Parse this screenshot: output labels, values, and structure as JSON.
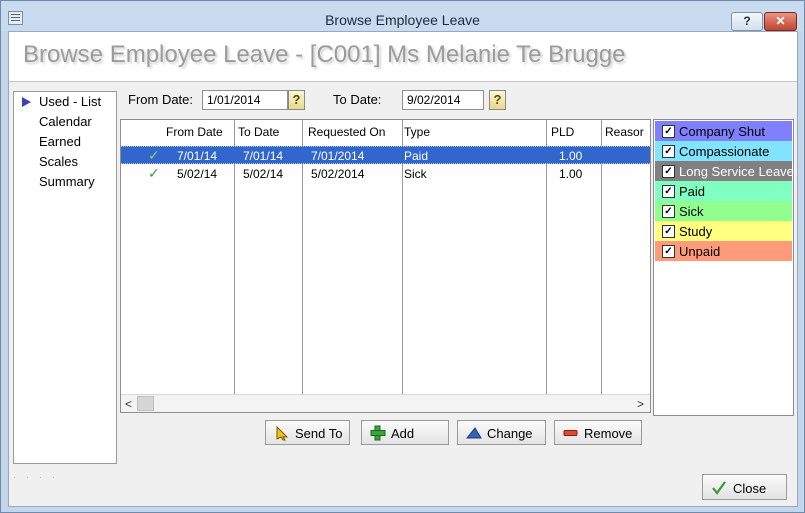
{
  "window": {
    "title": "Browse Employee Leave"
  },
  "titlebar_buttons": {
    "help": "?",
    "close": "✕"
  },
  "header": {
    "title": "Browse Employee Leave - [C001] Ms Melanie Te Brugge"
  },
  "nav": {
    "items": [
      "Used - List",
      "Calendar",
      "Earned",
      "Scales",
      "Summary"
    ],
    "selected_index": 0
  },
  "filters": {
    "from_label": "From Date:",
    "from_value": "1/01/2014",
    "to_label": "To Date:",
    "to_value": "9/02/2014",
    "lookup_symbol": "?"
  },
  "grid": {
    "columns": [
      "From Date",
      "To Date",
      "Requested On",
      "Type",
      "PLD",
      "Reasor"
    ],
    "rows": [
      {
        "from": "7/01/14",
        "to": "7/01/14",
        "requested": "7/01/2014",
        "type": "Paid",
        "pld": "1.00",
        "reason": "",
        "approved": true,
        "selected": true
      },
      {
        "from": "5/02/14",
        "to": "5/02/14",
        "requested": "5/02/2014",
        "type": "Sick",
        "pld": "1.00",
        "reason": "",
        "approved": true,
        "selected": false
      }
    ]
  },
  "leave_types": [
    {
      "label": "Company Shut",
      "color": "#8080ff",
      "text_color": "#000000",
      "checked": true
    },
    {
      "label": "Compassionate",
      "color": "#80e4ff",
      "text_color": "#000000",
      "checked": true
    },
    {
      "label": "Long Service Leave",
      "color": "#808080",
      "text_color": "#ffffff",
      "checked": true
    },
    {
      "label": "Paid",
      "color": "#80ffc0",
      "text_color": "#000000",
      "checked": true
    },
    {
      "label": "Sick",
      "color": "#90ff90",
      "text_color": "#000000",
      "checked": true
    },
    {
      "label": "Study",
      "color": "#ffff80",
      "text_color": "#000000",
      "checked": true
    },
    {
      "label": "Unpaid",
      "color": "#ff9a7a",
      "text_color": "#000000",
      "checked": true
    }
  ],
  "actions": {
    "send_to": "Send To",
    "add": "Add",
    "change": "Change",
    "remove": "Remove"
  },
  "footer": {
    "close": "Close"
  },
  "icons": {
    "approved": "check-icon",
    "send_to": "send-arrow-icon",
    "add": "plus-icon",
    "change": "triangle-icon",
    "remove": "minus-icon",
    "close": "check-icon"
  }
}
